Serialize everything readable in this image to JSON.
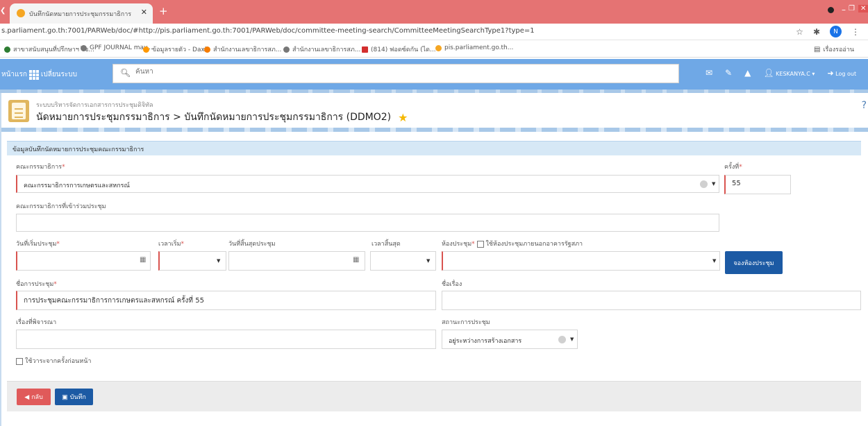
{
  "browser": {
    "tab_title": "บันทึกนัดหมายการประชุมกรรมาธิการ",
    "url": "s.parliament.go.th:7001/PARWeb/doc/#http://pis.parliament.go.th:7001/PARWeb/doc/committee-meeting-search/CommitteeMeetingSearchType1?type=1",
    "profile_initial": "N",
    "bookmarks": [
      {
        "label": "สาขาสนับสนุนที่ปรึกษาฯ ไซ...",
        "color": "#2e7d32"
      },
      {
        "label": "GPF JOURNAL may...",
        "color": "#777777"
      },
      {
        "label": "ข้อมูลรายตัว - Daxin",
        "color": "#ff9800"
      },
      {
        "label": "สำนักงานเลขาธิการสภ...",
        "color": "#f57c00"
      },
      {
        "label": "สำนักงานเลขาธิการสภ...",
        "color": "#777777"
      },
      {
        "label": "(814) ฟอดซ์ดกัน (ได...",
        "color": "#d32f2f"
      },
      {
        "label": "pis.parliament.go.th...",
        "color": "#f5a623"
      }
    ],
    "reading_list": "เรื่องรออ่าน"
  },
  "nav": {
    "home": "หน้าแรก",
    "switch_system": "เปลี่ยนระบบ",
    "search_placeholder": "ค้นหา",
    "user": "KESKANYA.C",
    "logout": "Log out"
  },
  "header": {
    "system_name": "ระบบบริหารจัดการเอกสารการประชุมดิจิทัล",
    "title": "นัดหมายการประชุมกรรมาธิการ > บันทึกนัดหมายการประชุมกรรมาธิการ (DDMO2)"
  },
  "form": {
    "panel_title": "ข้อมูลบันทึกนัดหมายการประชุมคณะกรรมาธิการ",
    "committee_label": "คณะกรรมาธิการ",
    "committee_value": "คณะกรรมาธิการการเกษตรและสหกรณ์",
    "session_label": "ครั้งที่",
    "session_value": "55",
    "joint_committee_label": "คณะกรรมาธิการที่เข้าร่วมประชุม",
    "joint_committee_value": "",
    "start_date_label": "วันที่เริ่มประชุม",
    "start_time_label": "เวลาเริ่ม",
    "end_date_label": "วันที่สิ้นสุดประชุม",
    "end_time_label": "เวลาสิ้นสุด",
    "room_label": "ห้องประชุม",
    "outside_room_label": "ใช้ห้องประชุมภายนอกอาคารรัฐสภา",
    "book_room_button": "จองห้องประชุม",
    "meeting_name_label": "ชื่อการประชุม",
    "meeting_name_value": "การประชุมคณะกรรมาธิการการเกษตรและสหกรณ์ ครั้งที่ 55",
    "topic_label": "ชื่อเรื่อง",
    "topic_value": "",
    "agenda_label": "เรื่องที่พิจารณา",
    "agenda_value": "",
    "status_label": "สถานะการประชุม",
    "status_value": "อยู่ระหว่างการสร้างเอกสาร",
    "use_previous_agenda_label": "ใช้วาระจากครั้งก่อนหน้า"
  },
  "footer": {
    "back_button": "กลับ",
    "save_button": "บันทึก"
  }
}
